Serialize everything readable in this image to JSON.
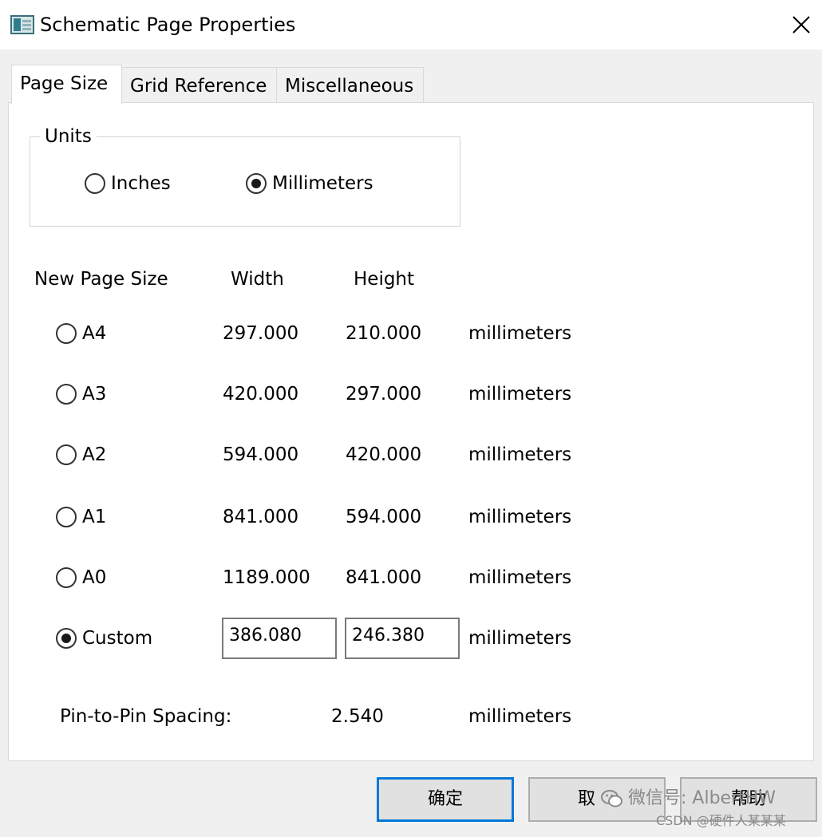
{
  "window": {
    "title": "Schematic Page Properties",
    "icon": "schematic-app-icon",
    "close_icon": "close-icon"
  },
  "tabs": [
    {
      "label": "Page Size",
      "active": true
    },
    {
      "label": "Grid Reference",
      "active": false
    },
    {
      "label": "Miscellaneous",
      "active": false
    }
  ],
  "units": {
    "legend": "Units",
    "options": [
      {
        "label": "Inches",
        "checked": false
      },
      {
        "label": "Millimeters",
        "checked": true
      }
    ]
  },
  "page_size": {
    "headers": {
      "name": "New Page Size",
      "width": "Width",
      "height": "Height"
    },
    "rows": [
      {
        "label": "A4",
        "width": "297.000",
        "height": "210.000",
        "unit": "millimeters",
        "checked": false
      },
      {
        "label": "A3",
        "width": "420.000",
        "height": "297.000",
        "unit": "millimeters",
        "checked": false
      },
      {
        "label": "A2",
        "width": "594.000",
        "height": "420.000",
        "unit": "millimeters",
        "checked": false
      },
      {
        "label": "A1",
        "width": "841.000",
        "height": "594.000",
        "unit": "millimeters",
        "checked": false
      },
      {
        "label": "A0",
        "width": "1189.000",
        "height": "841.000",
        "unit": "millimeters",
        "checked": false
      }
    ],
    "custom": {
      "label": "Custom",
      "width": "386.080",
      "height": "246.380",
      "unit": "millimeters",
      "checked": true
    }
  },
  "pin_spacing": {
    "label": "Pin-to-Pin Spacing:",
    "value": "2.540",
    "unit": "millimeters"
  },
  "buttons": {
    "ok": "确定",
    "cancel": "取",
    "help": "帮助"
  },
  "watermark": {
    "line1": "微信号: AlbertHW",
    "line2": "CSDN @硬件人某某某"
  }
}
